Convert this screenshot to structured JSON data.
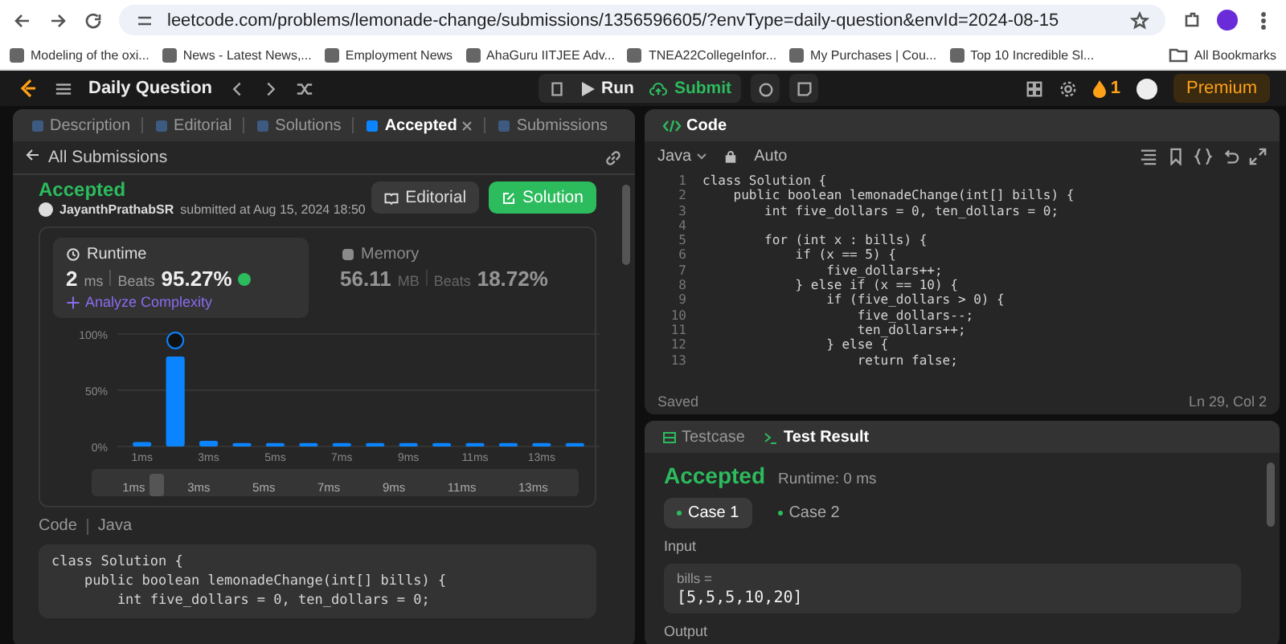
{
  "browser": {
    "url": "leetcode.com/problems/lemonade-change/submissions/1356596605/?envType=daily-question&envId=2024-08-15",
    "bookmarks": [
      "Modeling of the oxi...",
      "News - Latest News,...",
      "Employment News",
      "AhaGuru IITJEE Adv...",
      "TNEA22CollegeInfor...",
      "My Purchases | Cou...",
      "Top 10 Incredible Sl..."
    ],
    "all_bookmarks": "All Bookmarks"
  },
  "navbar": {
    "title": "Daily Question",
    "run": "Run",
    "submit": "Submit",
    "streak": "1",
    "premium": "Premium"
  },
  "left_tabs": [
    {
      "label": "Description",
      "selected": false,
      "closable": false
    },
    {
      "label": "Editorial",
      "selected": false,
      "closable": false
    },
    {
      "label": "Solutions",
      "selected": false,
      "closable": false
    },
    {
      "label": "Accepted",
      "selected": true,
      "closable": true
    },
    {
      "label": "Submissions",
      "selected": false,
      "closable": false
    }
  ],
  "back_link": "All Submissions",
  "submission": {
    "status": "Accepted",
    "user": "JayanthPrathabSR",
    "submitted": "submitted at Aug 15, 2024 18:50",
    "editorial_button": "Editorial",
    "solution_button": "Solution"
  },
  "runtime": {
    "label": "Runtime",
    "value": "2",
    "unit": "ms",
    "beats_label": "Beats",
    "beats": "95.27%",
    "analyze": "Analyze Complexity",
    "selected": true
  },
  "memory": {
    "label": "Memory",
    "value": "56.11",
    "unit": "MB",
    "beats_label": "Beats",
    "beats": "18.72%",
    "selected": false
  },
  "chart_data": {
    "type": "bar",
    "categories": [
      "1ms",
      null,
      "3ms",
      null,
      "5ms",
      null,
      "7ms",
      null,
      "9ms",
      null,
      "11ms",
      null,
      "13ms",
      null
    ],
    "values": [
      0.04,
      0.8,
      0.05,
      0.03,
      0.03,
      0.03,
      0.03,
      0.03,
      0.03,
      0.03,
      0.03,
      0.03,
      0.03,
      0.03
    ],
    "ylim": [
      0,
      1
    ],
    "yticks": [
      {
        "value": 0,
        "label": "0%"
      },
      {
        "value": 0.5,
        "label": "50%"
      },
      {
        "value": 1,
        "label": "100%"
      }
    ]
  },
  "navigator_labels": [
    "1ms",
    "3ms",
    "5ms",
    "7ms",
    "9ms",
    "11ms",
    "13ms"
  ],
  "code_section": {
    "label": "Code",
    "language": "Java",
    "lines": [
      "class Solution {",
      "    public boolean lemonadeChange(int[] bills) {",
      "        int five_dollars = 0, ten_dollars = 0;"
    ]
  },
  "editor": {
    "title": "Code",
    "language": "Java",
    "mode": "Auto",
    "status": "Saved",
    "position": "Ln 29, Col 2",
    "lines": [
      {
        "n": "1",
        "text": "class Solution {"
      },
      {
        "n": "2",
        "text": "    public boolean lemonadeChange(int[] bills) {"
      },
      {
        "n": "3",
        "text": "        int five_dollars = 0, ten_dollars = 0;"
      },
      {
        "n": "4"
      },
      {
        "n": "5",
        "text": "        for (int x : bills) {"
      },
      {
        "n": "6",
        "text": "            if (x == 5) {"
      },
      {
        "n": "7",
        "text": "                five_dollars++;"
      },
      {
        "n": "8",
        "text": "            } else if (x == 10) {"
      },
      {
        "n": "9",
        "text": "                if (five_dollars > 0) {"
      },
      {
        "n": "10",
        "text": "                    five_dollars--;"
      },
      {
        "n": "11",
        "text": "                    ten_dollars++;"
      },
      {
        "n": "12",
        "text": "                } else {"
      },
      {
        "n": "13",
        "text": "                    return false;"
      }
    ]
  },
  "result_tabs": [
    {
      "label": "Testcase",
      "selected": false
    },
    {
      "label": "Test Result",
      "selected": true
    }
  ],
  "result": {
    "status": "Accepted",
    "runtime": "Runtime: 0 ms",
    "cases": [
      {
        "label": "Case 1",
        "selected": true
      },
      {
        "label": "Case 2",
        "selected": false
      }
    ],
    "input_label": "Input",
    "var_name": "bills =",
    "var_value": "[5,5,5,10,20]",
    "output_label": "Output"
  }
}
